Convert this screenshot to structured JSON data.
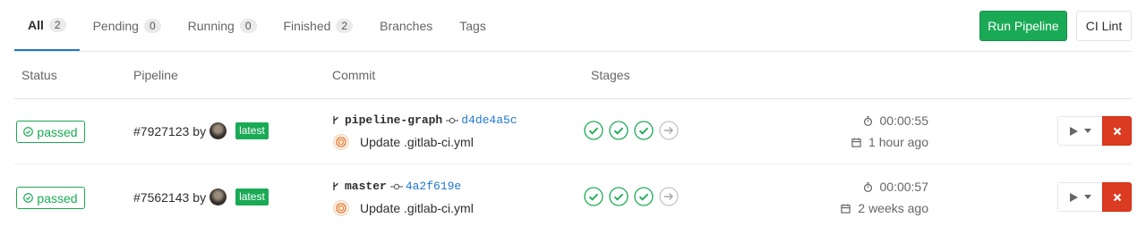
{
  "tabs": [
    {
      "label": "All",
      "count": "2"
    },
    {
      "label": "Pending",
      "count": "0"
    },
    {
      "label": "Running",
      "count": "0"
    },
    {
      "label": "Finished",
      "count": "2"
    },
    {
      "label": "Branches"
    },
    {
      "label": "Tags"
    }
  ],
  "actions": {
    "run_pipeline": "Run Pipeline",
    "ci_lint": "CI Lint"
  },
  "table": {
    "headers": {
      "status": "Status",
      "pipeline": "Pipeline",
      "commit": "Commit",
      "stages": "Stages"
    },
    "rows": [
      {
        "status": "passed",
        "pipeline_id": "#7927123",
        "by": "by",
        "tag": "latest",
        "ref": "pipeline-graph",
        "sha": "d4de4a5c",
        "message": "Update .gitlab-ci.yml",
        "duration": "00:00:55",
        "finished_ago": "1 hour ago"
      },
      {
        "status": "passed",
        "pipeline_id": "#7562143",
        "by": "by",
        "tag": "latest",
        "ref": "master",
        "sha": "4a2f619e",
        "message": "Update .gitlab-ci.yml",
        "duration": "00:00:57",
        "finished_ago": "2 weeks ago"
      }
    ]
  },
  "colors": {
    "success": "#1aaa55",
    "link": "#1f78d1",
    "danger": "#db3b21"
  }
}
